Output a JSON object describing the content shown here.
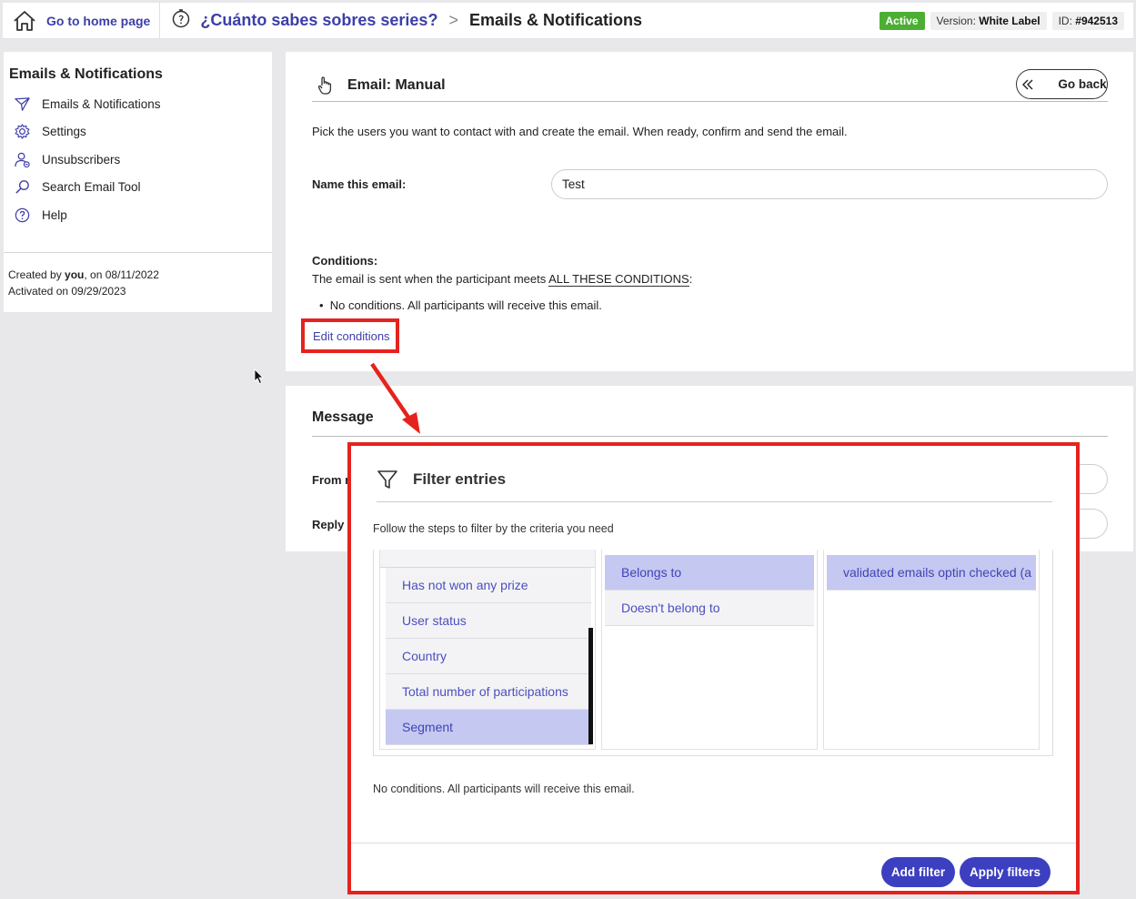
{
  "topbar": {
    "home_label": "Go to home page",
    "contest_name": "¿Cuánto sabes sobres series?",
    "separator": ">",
    "current_page": "Emails & Notifications",
    "status": "Active",
    "version_label": "Version:",
    "version_value": "White Label",
    "id_label": "ID:",
    "id_value": "#942513",
    "status_color": "#4caf33",
    "link_color": "#3c3fa8"
  },
  "sidebar": {
    "title": "Emails & Notifications",
    "items": [
      {
        "label": "Emails & Notifications",
        "icon": "paper-plane-icon"
      },
      {
        "label": "Settings",
        "icon": "gear-icon"
      },
      {
        "label": "Unsubscribers",
        "icon": "user-minus-icon"
      },
      {
        "label": "Search Email Tool",
        "icon": "search-icon"
      },
      {
        "label": "Help",
        "icon": "help-icon"
      }
    ],
    "created_prefix": "Created by ",
    "created_by": "you",
    "created_suffix": ", on 08/11/2022",
    "activated": "Activated on 09/29/2023"
  },
  "email": {
    "title": "Email: Manual",
    "go_back": "Go back",
    "intro": "Pick the users you want to contact with and create the email. When ready, confirm and send the email.",
    "name_label": "Name this email:",
    "name_value": "Test",
    "conditions_label": "Conditions:",
    "conditions_text_pre": "The email is sent when the participant meets ",
    "conditions_text_link": "ALL THESE CONDITIONS",
    "conditions_text_post": ":",
    "conditions_bullet": "No conditions. All participants will receive this email.",
    "edit_conditions": "Edit conditions"
  },
  "message": {
    "title": "Message",
    "from_label": "From n",
    "reply_label": "Reply t"
  },
  "modal": {
    "title": "Filter entries",
    "subtitle": "Follow the steps to filter by the criteria you need",
    "column1": [
      "Has not won any prize",
      "User status",
      "Country",
      "Total number of participations",
      "Segment"
    ],
    "column1_selected": "Segment",
    "column2": [
      "Belongs to",
      "Doesn't belong to"
    ],
    "column2_selected": "Belongs to",
    "column3": [
      "validated emails optin checked (a"
    ],
    "no_conditions": "No conditions. All participants will receive this email.",
    "add_filter": "Add filter",
    "apply_filters": "Apply filters",
    "button_color": "#3c3fc0",
    "highlight_color": "#e5231e"
  }
}
